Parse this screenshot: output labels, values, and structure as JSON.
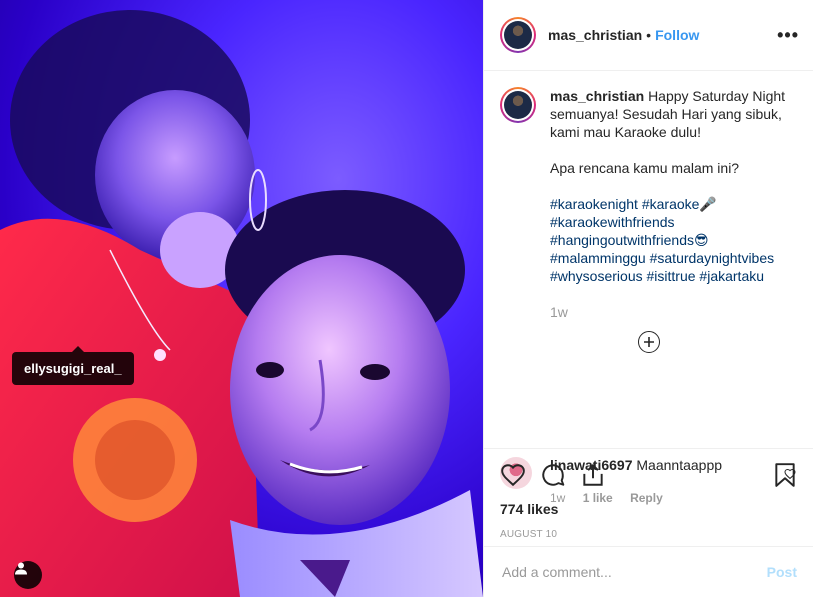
{
  "photo": {
    "tag_label": "ellysugigi_real_",
    "tag_icon": "user-icon"
  },
  "header": {
    "username": "mas_christian",
    "separator": "•",
    "follow_label": "Follow",
    "more_label": "•••"
  },
  "caption": {
    "username": "mas_christian",
    "line1": "Happy Saturday Night semuanya! Sesudah Hari yang sibuk, kami mau Karaoke dulu!",
    "line2": "Apa rencana kamu malam ini?",
    "hashtags": [
      "#karaokenight",
      "#karaoke🎤",
      "#karaokewithfriends",
      "#hangingoutwithfriends😎",
      "#malamminggu",
      "#saturdaynightvibes",
      "#whysoserious",
      "#isittrue",
      "#jakartaku"
    ],
    "time_ago": "1w",
    "load_more_label": "+"
  },
  "comment": {
    "username": "linawati6697",
    "text": "Maanntaappp",
    "time_ago": "1w",
    "likes": "1 like",
    "reply_label": "Reply"
  },
  "actions": {
    "likes": "774 likes",
    "date": "AUGUST 10"
  },
  "add_comment": {
    "placeholder": "Add a comment...",
    "post_label": "Post"
  },
  "colors": {
    "accent": "#3897f0",
    "hashtag": "#003569",
    "muted": "#999999",
    "post_disabled": "#b2dffc"
  }
}
